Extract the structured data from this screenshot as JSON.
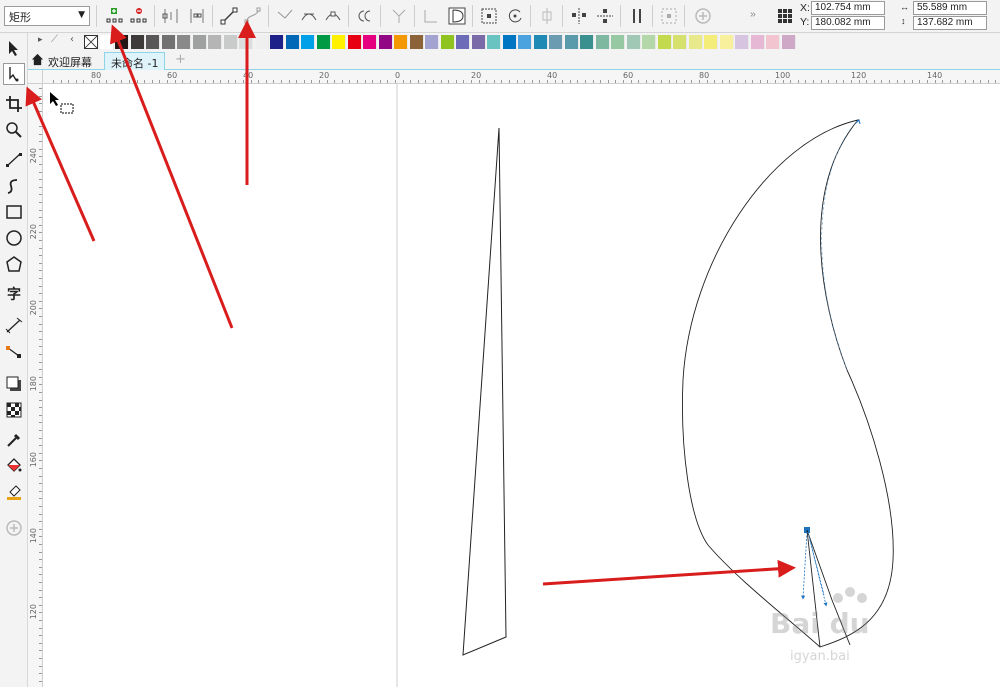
{
  "property_bar": {
    "shape_select_value": "矩形",
    "x_label": "X:",
    "x_value": "102.754 mm",
    "y_label": "Y:",
    "y_value": "180.082 mm",
    "width_value": "55.589 mm",
    "height_value": "137.682 mm"
  },
  "tabs": {
    "welcome": "欢迎屏幕",
    "document": "未命名 -1",
    "add": "+"
  },
  "rulers": {
    "horizontal_labels": [
      "80",
      "60",
      "40",
      "20",
      "0",
      "20",
      "40",
      "60",
      "80",
      "100",
      "120",
      "140"
    ],
    "vertical_labels": [
      "240",
      "220",
      "200",
      "180",
      "160",
      "140",
      "120"
    ]
  },
  "palette": {
    "colors": [
      "#ffffff",
      "#231815",
      "#3e3a39",
      "#595757",
      "#727171",
      "#898989",
      "#9fa0a0",
      "#b5b5b6",
      "#c9caca",
      "#dcdddd",
      "#efefef",
      "#1d2088",
      "#0068b7",
      "#00a0e9",
      "#009944",
      "#fff100",
      "#e60012",
      "#e4007f",
      "#920783",
      "#f39800",
      "#8c6239",
      "#a3a3d1",
      "#8fc31f",
      "#6c6cb8",
      "#7b6aa8",
      "#69c3c0",
      "#0075c2",
      "#4aa3df",
      "#1f8ab3",
      "#6b9bb0",
      "#5a9bab",
      "#3a8f8f",
      "#7fb8a0",
      "#96c8a2",
      "#a0c8b4",
      "#b3d7a8",
      "#c3d94e",
      "#d6e06c",
      "#e8e98a",
      "#f5ed7a",
      "#f8f09c",
      "#d7c4e0",
      "#e6b8d6",
      "#f2c4cf",
      "#cfa8c8"
    ]
  },
  "watermark": {
    "text": "Bai du",
    "sub": "igyan.bai"
  },
  "colors": {
    "arrow_red": "#d91c1c",
    "node_blue": "#1e73be",
    "guide_blue": "#8fd3e6"
  }
}
